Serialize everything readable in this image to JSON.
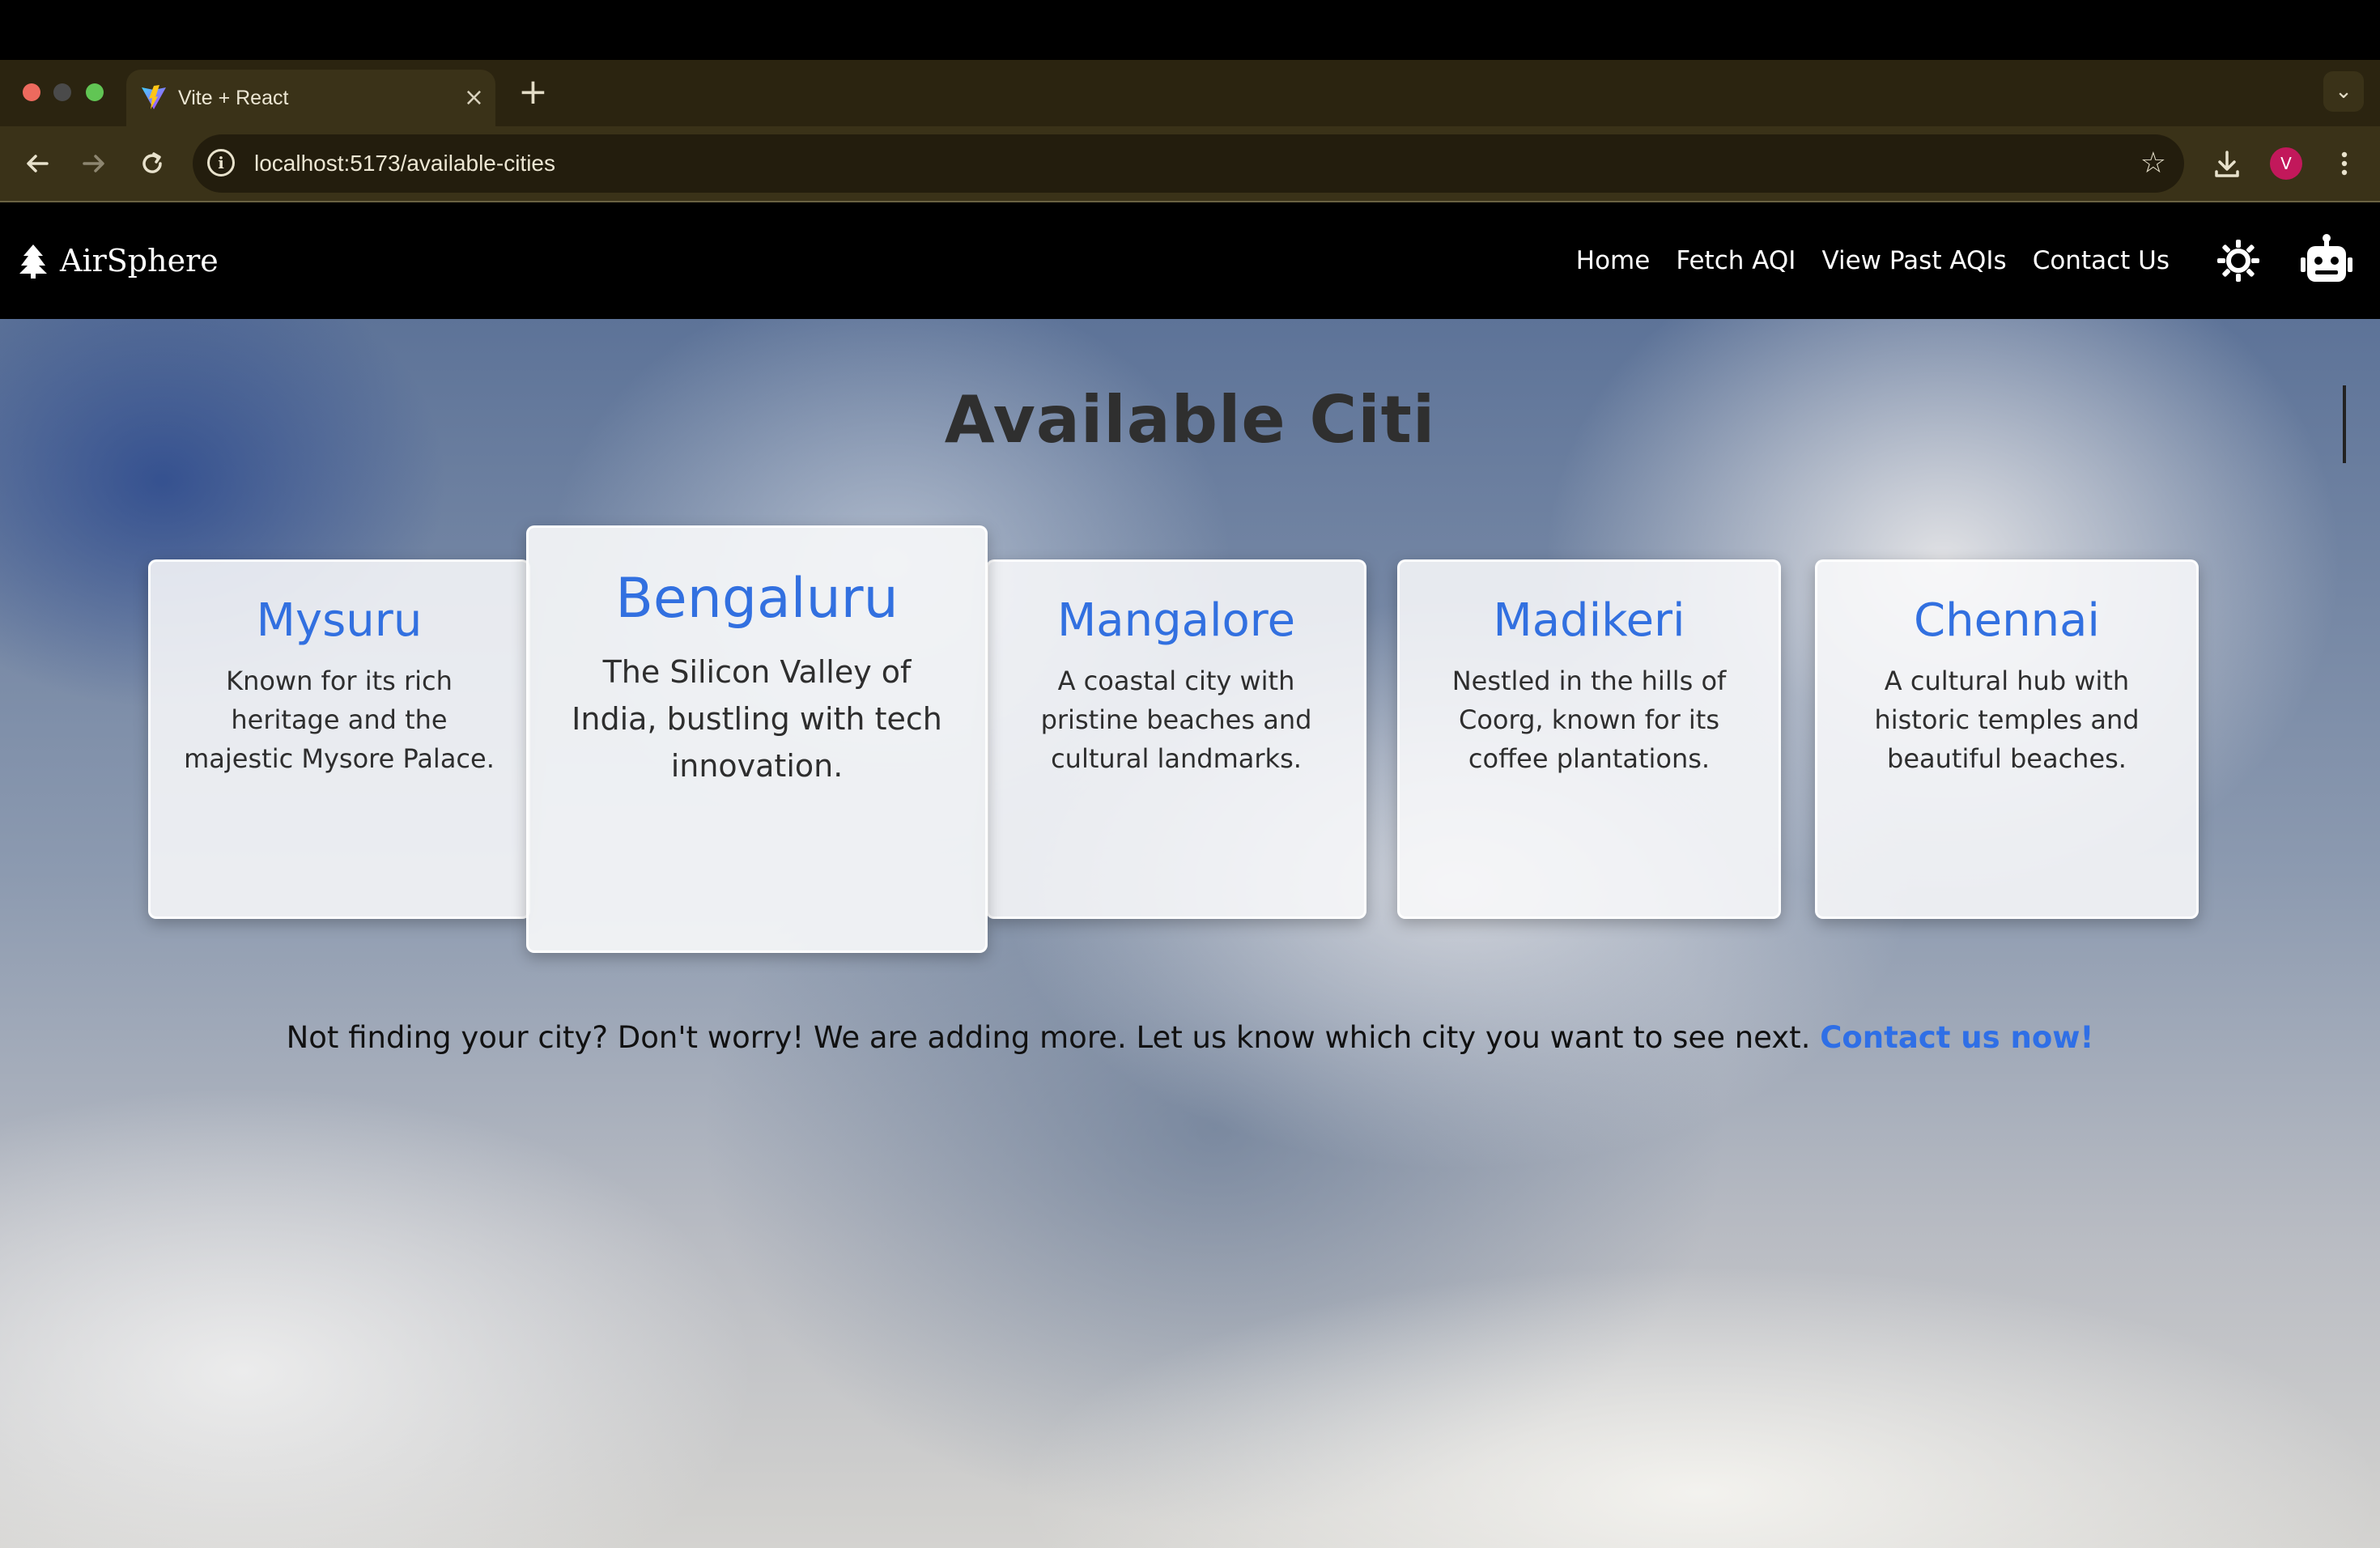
{
  "browser": {
    "tab_title": "Vite + React",
    "url": "localhost:5173/available-cities",
    "profile_initial": "V",
    "icons": [
      "back-icon",
      "forward-icon",
      "reload-icon",
      "site-info-icon",
      "star-icon",
      "download-icon",
      "menu-icon",
      "close-icon",
      "plus-icon",
      "chevron-down-icon"
    ],
    "colors": {
      "traffic_red": "#ed6a5e",
      "traffic_yellow": "#4a4a4a",
      "traffic_green": "#61c554"
    }
  },
  "nav": {
    "brand": "AirSphere",
    "links": [
      "Home",
      "Fetch AQI",
      "View Past AQIs",
      "Contact Us"
    ],
    "icons": [
      "tree-icon",
      "sun-icon",
      "robot-icon"
    ]
  },
  "page": {
    "title": "Available Citi",
    "cities": [
      {
        "name": "Mysuru",
        "description": "Known for its rich heritage and the majestic Mysore Palace."
      },
      {
        "name": "Bengaluru",
        "description": "The Silicon Valley of India, bustling with tech innovation."
      },
      {
        "name": "Mangalore",
        "description": "A coastal city with pristine beaches and cultural landmarks."
      },
      {
        "name": "Madikeri",
        "description": "Nestled in the hills of Coorg, known for its coffee plantations."
      },
      {
        "name": "Chennai",
        "description": "A cultural hub with historic temples and beautiful beaches."
      }
    ],
    "notice_text": "Not finding your city? Don't worry! We are adding more. Let us know which city you want to see next.",
    "notice_link": "Contact us now!",
    "colors": {
      "city_name": "#3270e0",
      "link": "#2f6fe6"
    }
  }
}
